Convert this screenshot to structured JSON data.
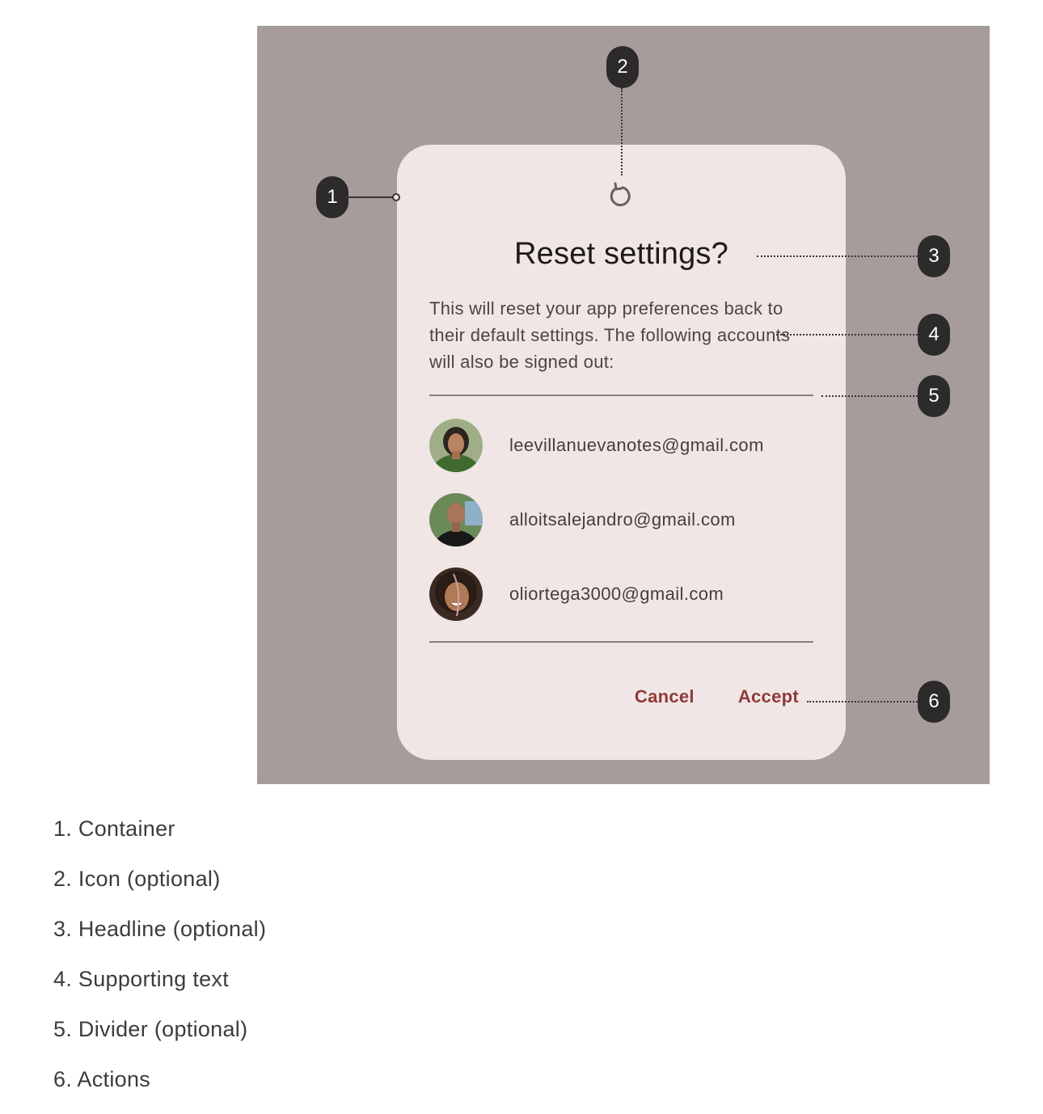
{
  "dialog": {
    "icon": "reset-icon",
    "headline": "Reset settings?",
    "supporting_text": "This will reset your app preferences back to their default settings. The following accounts will also be signed out:",
    "accounts": [
      {
        "email": "leevillanuevanotes@gmail.com",
        "avatar": "avatar-photo"
      },
      {
        "email": "alloitsalejandro@gmail.com",
        "avatar": "avatar-photo"
      },
      {
        "email": "oliortega3000@gmail.com",
        "avatar": "avatar-photo"
      }
    ],
    "actions": {
      "cancel": "Cancel",
      "accept": "Accept"
    }
  },
  "callouts": [
    "1",
    "2",
    "3",
    "4",
    "5",
    "6"
  ],
  "legend": [
    "1. Container",
    "2. Icon (optional)",
    "3. Headline (optional)",
    "4. Supporting text",
    "5. Divider (optional)",
    "6. Actions"
  ],
  "colors": {
    "stage_bg": "#a69d9b",
    "dialog_bg": "#f0e6e5",
    "action_text": "#8e3a3a",
    "callout_bg": "#2c2a2a"
  }
}
